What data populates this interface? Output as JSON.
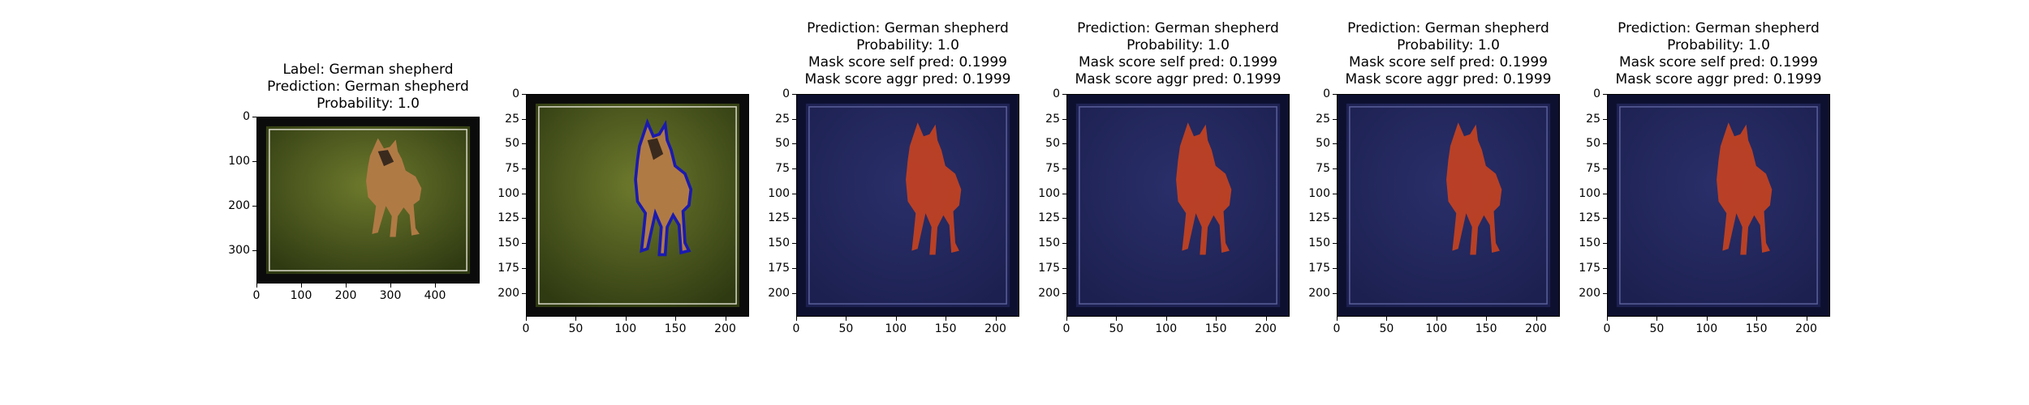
{
  "panels": [
    {
      "title_lines": [
        "Label: German shepherd",
        "Prediction: German shepherd",
        "Probability: 1.0"
      ],
      "x_ticks": [
        "0",
        "100",
        "200",
        "300",
        "400"
      ],
      "y_ticks": [
        "0",
        "100",
        "200",
        "300"
      ],
      "image_kind": "original",
      "x_max": 500,
      "y_max": 375
    },
    {
      "title_lines": [],
      "x_ticks": [
        "0",
        "50",
        "100",
        "150",
        "200"
      ],
      "y_ticks": [
        "0",
        "25",
        "50",
        "75",
        "100",
        "125",
        "150",
        "175",
        "200"
      ],
      "image_kind": "contour",
      "x_max": 224,
      "y_max": 224
    },
    {
      "title_lines": [
        "Prediction: German shepherd",
        "Probability: 1.0",
        "Mask score self pred: 0.1999",
        "Mask score aggr pred: 0.1999"
      ],
      "x_ticks": [
        "0",
        "50",
        "100",
        "150",
        "200"
      ],
      "y_ticks": [
        "0",
        "25",
        "50",
        "75",
        "100",
        "125",
        "150",
        "175",
        "200"
      ],
      "image_kind": "mask",
      "x_max": 224,
      "y_max": 224
    },
    {
      "title_lines": [
        "Prediction: German shepherd",
        "Probability: 1.0",
        "Mask score self pred: 0.1999",
        "Mask score aggr pred: 0.1999"
      ],
      "x_ticks": [
        "0",
        "50",
        "100",
        "150",
        "200"
      ],
      "y_ticks": [
        "0",
        "25",
        "50",
        "75",
        "100",
        "125",
        "150",
        "175",
        "200"
      ],
      "image_kind": "mask",
      "x_max": 224,
      "y_max": 224
    },
    {
      "title_lines": [
        "Prediction: German shepherd",
        "Probability: 1.0",
        "Mask score self pred: 0.1999",
        "Mask score aggr pred: 0.1999"
      ],
      "x_ticks": [
        "0",
        "50",
        "100",
        "150",
        "200"
      ],
      "y_ticks": [
        "0",
        "25",
        "50",
        "75",
        "100",
        "125",
        "150",
        "175",
        "200"
      ],
      "image_kind": "mask",
      "x_max": 224,
      "y_max": 224
    },
    {
      "title_lines": [
        "Prediction: German shepherd",
        "Probability: 1.0",
        "Mask score self pred: 0.1999",
        "Mask score aggr pred: 0.1999"
      ],
      "x_ticks": [
        "0",
        "50",
        "100",
        "150",
        "200"
      ],
      "y_ticks": [
        "0",
        "25",
        "50",
        "75",
        "100",
        "125",
        "150",
        "175",
        "200"
      ],
      "image_kind": "mask",
      "x_max": 224,
      "y_max": 224
    }
  ],
  "colors": {
    "frame_black": "#0b0b0b",
    "frame_line": "#d8d8c8",
    "grass_light": "#6d7a2c",
    "grass_dark": "#2f3a12",
    "dog_tan": "#b07a45",
    "dog_dark": "#3a2a1e",
    "contour": "#1a1ab0",
    "mask_bg": "#1c2050",
    "mask_dog": "#c9431f"
  }
}
